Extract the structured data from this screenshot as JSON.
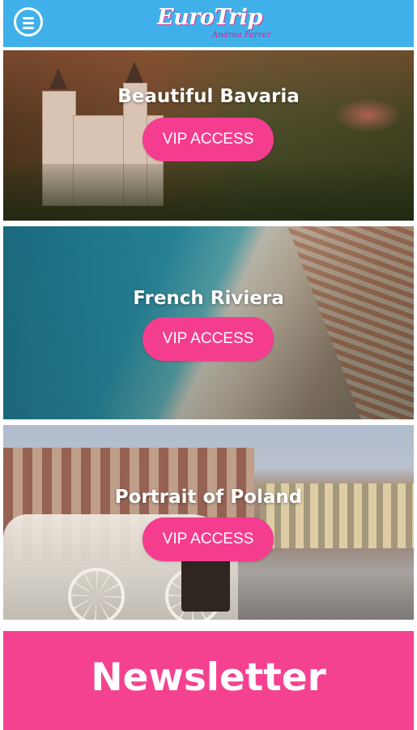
{
  "header": {
    "menu_icon": "hamburger-menu-icon",
    "logo_text": "EuroTrip",
    "logo_subtext": "Andrea Farrer",
    "background_color": "#3fb0ea",
    "logo_accent_color": "#e8198b"
  },
  "destinations": [
    {
      "title": "Beautiful Bavaria",
      "button_label": "VIP ACCESS"
    },
    {
      "title": "French Riviera",
      "button_label": "VIP ACCESS"
    },
    {
      "title": "Portrait of Poland",
      "button_label": "VIP ACCESS"
    }
  ],
  "button_color": "#f53d8f",
  "newsletter": {
    "label": "Newsletter",
    "background_color": "#f54290"
  }
}
